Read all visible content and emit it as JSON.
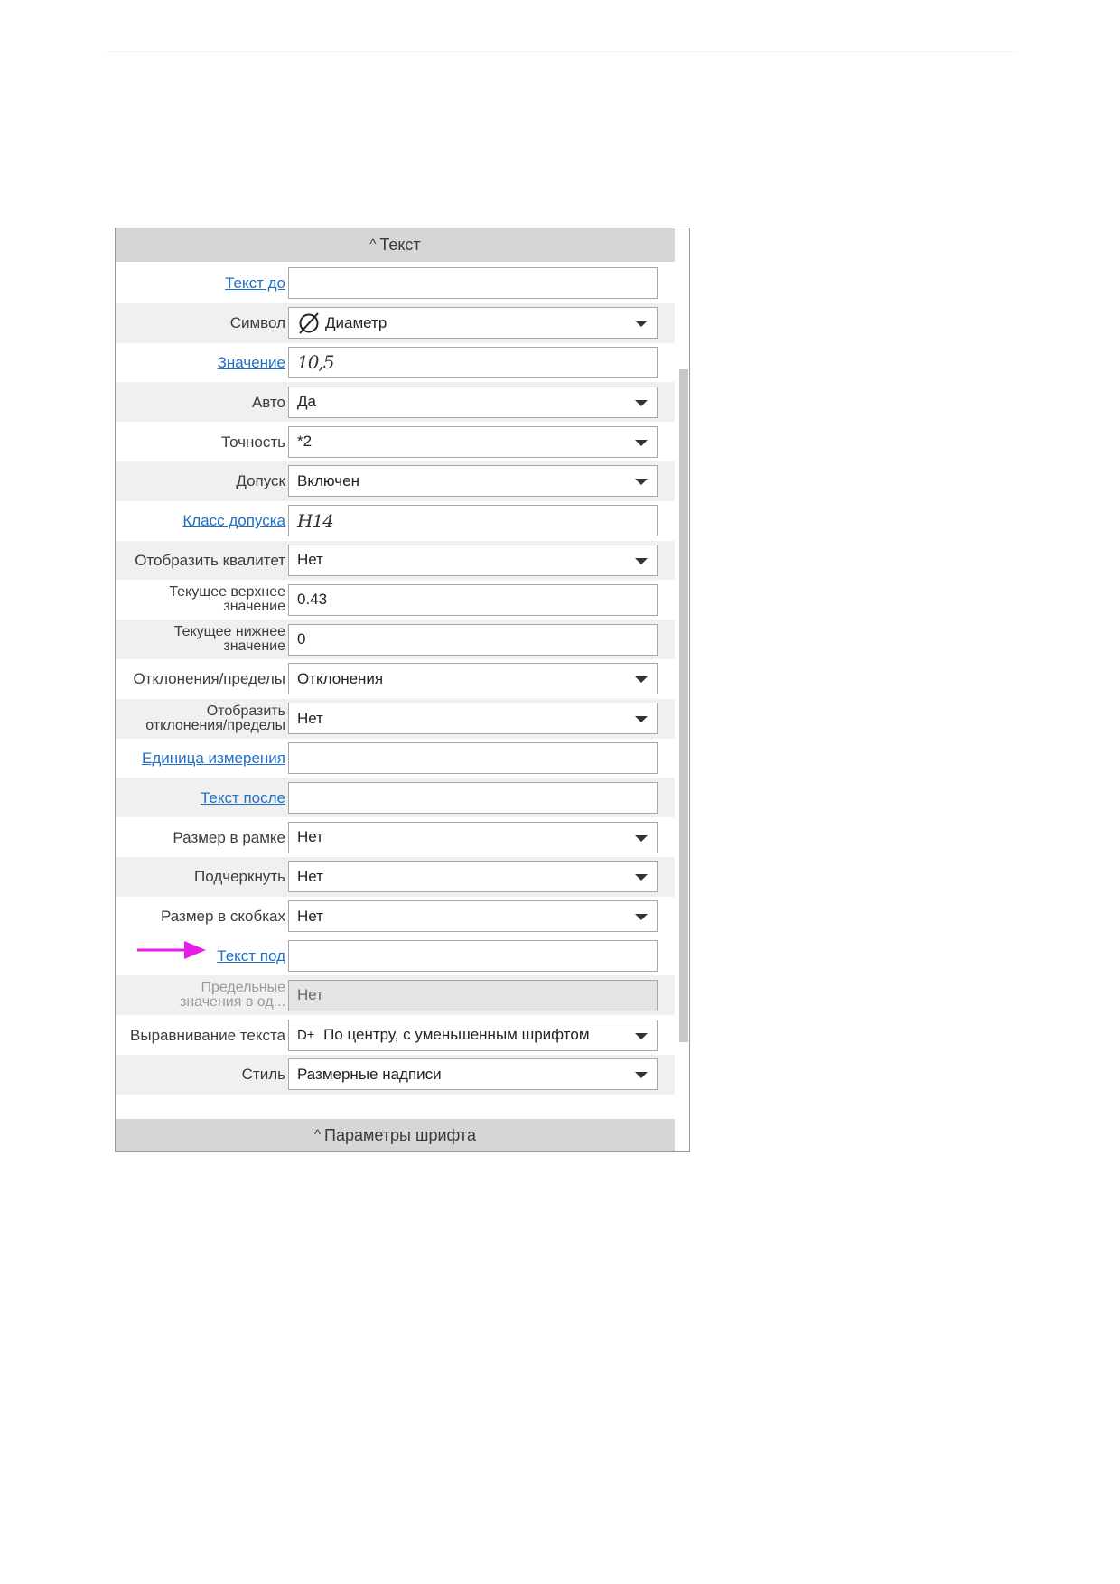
{
  "panel": {
    "header_title": "Текст",
    "footer_title": "Параметры шрифта",
    "accent_link_color": "#1f6fc7",
    "annotation_arrow_color": "#e81ee8",
    "rows": [
      {
        "label": "Текст до",
        "value": ""
      },
      {
        "label": "Символ",
        "value": "Диаметр",
        "icon": "diameter-icon"
      },
      {
        "label": "Значение",
        "value": "10,5"
      },
      {
        "label": "Авто",
        "value": "Да"
      },
      {
        "label": "Точность",
        "value": "*2"
      },
      {
        "label": "Допуск",
        "value": "Включен"
      },
      {
        "label": "Класс допуска",
        "value": "H14"
      },
      {
        "label": "Отобразить квалитет",
        "value": "Нет"
      },
      {
        "label_line1": "Текущее верхнее",
        "label_line2": "значение",
        "value": "0.43"
      },
      {
        "label_line1": "Текущее нижнее",
        "label_line2": "значение",
        "value": "0"
      },
      {
        "label": "Отклонения/пределы",
        "value": "Отклонения"
      },
      {
        "label_line1": "Отобразить",
        "label_line2": "отклонения/пределы",
        "value": "Нет"
      },
      {
        "label": "Единица измерения",
        "value": ""
      },
      {
        "label": "Текст после",
        "value": ""
      },
      {
        "label": "Размер в рамке",
        "value": "Нет"
      },
      {
        "label": "Подчеркнуть",
        "value": "Нет"
      },
      {
        "label": "Размер в скобках",
        "value": "Нет"
      },
      {
        "label": "Текст под",
        "value": ""
      },
      {
        "label_line1": "Предельные",
        "label_line2": "значения в од...",
        "value": "Нет"
      },
      {
        "label": "Выравнивание текста",
        "value": "По центру, с уменьшенным шрифтом",
        "icon_text": "D±"
      },
      {
        "label": "Стиль",
        "value": "Размерные надписи"
      }
    ]
  }
}
